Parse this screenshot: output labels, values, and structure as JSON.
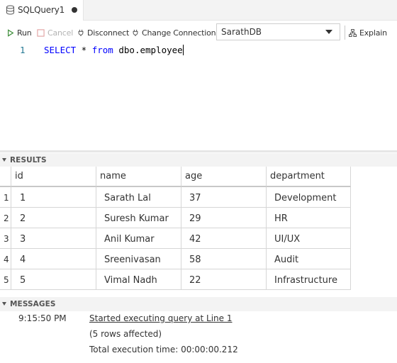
{
  "tab": {
    "title": "SQLQuery1",
    "unsaved_indicator": true
  },
  "toolbar": {
    "run_label": "Run",
    "cancel_label": "Cancel",
    "disconnect_label": "Disconnect",
    "change_connection_label": "Change Connection",
    "connection_value": "SarathDB",
    "explain_label": "Explain"
  },
  "editor": {
    "line_number": "1",
    "tokens": {
      "select": "SELECT",
      "star": " * ",
      "from": "from",
      "table": " dbo.employee"
    }
  },
  "results": {
    "header": "RESULTS",
    "columns": [
      "id",
      "name",
      "age",
      "department"
    ],
    "rows": [
      {
        "num": "1",
        "cells": [
          "1",
          "Sarath Lal",
          "37",
          "Development"
        ]
      },
      {
        "num": "2",
        "cells": [
          "2",
          "Suresh Kumar",
          "29",
          "HR"
        ]
      },
      {
        "num": "3",
        "cells": [
          "3",
          "Anil Kumar",
          "42",
          "UI/UX"
        ]
      },
      {
        "num": "4",
        "cells": [
          "4",
          "Sreenivasan",
          "58",
          "Audit"
        ]
      },
      {
        "num": "5",
        "cells": [
          "5",
          "Vimal Nadh",
          "22",
          "Infrastructure"
        ]
      }
    ]
  },
  "messages": {
    "header": "MESSAGES",
    "time": "9:15:50 PM",
    "started": "Started executing query at Line 1",
    "affected": "(5 rows affected)",
    "total": "Total execution time: 00:00:00.212"
  },
  "colors": {
    "keyword": "#0000ff",
    "line_number": "#237893",
    "run_icon": "#388a34"
  }
}
